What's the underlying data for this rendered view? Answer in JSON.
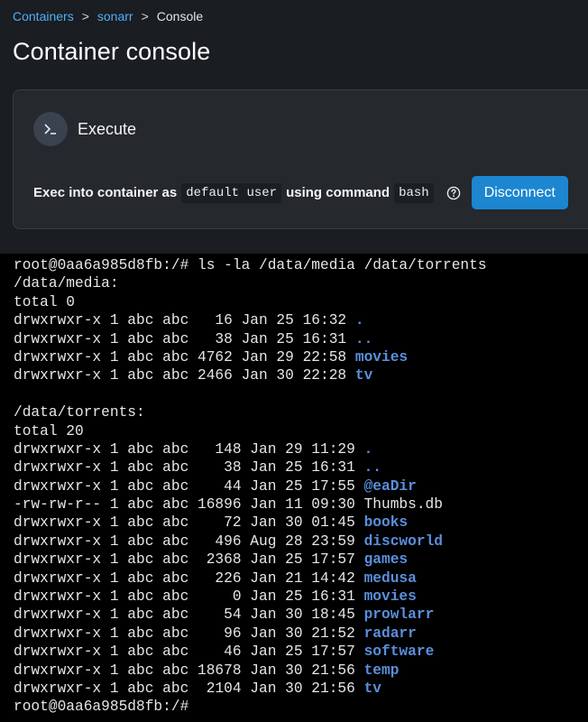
{
  "breadcrumb": {
    "items": [
      "Containers",
      "sonarr"
    ],
    "separator": ">",
    "current": "Console"
  },
  "page": {
    "title": "Container console"
  },
  "panel": {
    "title": "Execute",
    "icon": "terminal-prompt-icon",
    "exec_prefix": "Exec into container as",
    "user": "default user",
    "using_label": "using command",
    "command": "bash",
    "help_icon": "help-circle-icon",
    "disconnect_label": "Disconnect"
  },
  "colors": {
    "accent": "#1c86d0",
    "link": "#4fb0f6",
    "background": "#1a1d21",
    "panel": "#25282d",
    "terminal_bg": "#000000",
    "directory": "#5a8fdc"
  },
  "terminal": {
    "lines": [
      {
        "text": "root@0aa6a985d8fb:/# ls -la /data/media /data/torrents",
        "name": ""
      },
      {
        "text": "/data/media:",
        "name": ""
      },
      {
        "text": "total 0",
        "name": ""
      },
      {
        "text": "drwxrwxr-x 1 abc abc   16 Jan 25 16:32 ",
        "name": "."
      },
      {
        "text": "drwxrwxr-x 1 abc abc   38 Jan 25 16:31 ",
        "name": ".."
      },
      {
        "text": "drwxrwxr-x 1 abc abc 4762 Jan 29 22:58 ",
        "name": "movies"
      },
      {
        "text": "drwxrwxr-x 1 abc abc 2466 Jan 30 22:28 ",
        "name": "tv"
      },
      {
        "text": "",
        "name": ""
      },
      {
        "text": "/data/torrents:",
        "name": ""
      },
      {
        "text": "total 20",
        "name": ""
      },
      {
        "text": "drwxrwxr-x 1 abc abc   148 Jan 29 11:29 ",
        "name": "."
      },
      {
        "text": "drwxrwxr-x 1 abc abc    38 Jan 25 16:31 ",
        "name": ".."
      },
      {
        "text": "drwxrwxr-x 1 abc abc    44 Jan 25 17:55 ",
        "name": "@eaDir"
      },
      {
        "text": "-rw-rw-r-- 1 abc abc 16896 Jan 11 09:30 Thumbs.db",
        "name": ""
      },
      {
        "text": "drwxrwxr-x 1 abc abc    72 Jan 30 01:45 ",
        "name": "books"
      },
      {
        "text": "drwxrwxr-x 1 abc abc   496 Aug 28 23:59 ",
        "name": "discworld"
      },
      {
        "text": "drwxrwxr-x 1 abc abc  2368 Jan 25 17:57 ",
        "name": "games"
      },
      {
        "text": "drwxrwxr-x 1 abc abc   226 Jan 21 14:42 ",
        "name": "medusa"
      },
      {
        "text": "drwxrwxr-x 1 abc abc     0 Jan 25 16:31 ",
        "name": "movies"
      },
      {
        "text": "drwxrwxr-x 1 abc abc    54 Jan 30 18:45 ",
        "name": "prowlarr"
      },
      {
        "text": "drwxrwxr-x 1 abc abc    96 Jan 30 21:52 ",
        "name": "radarr"
      },
      {
        "text": "drwxrwxr-x 1 abc abc    46 Jan 25 17:57 ",
        "name": "software"
      },
      {
        "text": "drwxrwxr-x 1 abc abc 18678 Jan 30 21:56 ",
        "name": "temp"
      },
      {
        "text": "drwxrwxr-x 1 abc abc  2104 Jan 30 21:56 ",
        "name": "tv"
      },
      {
        "text": "root@0aa6a985d8fb:/# ",
        "name": ""
      }
    ]
  }
}
